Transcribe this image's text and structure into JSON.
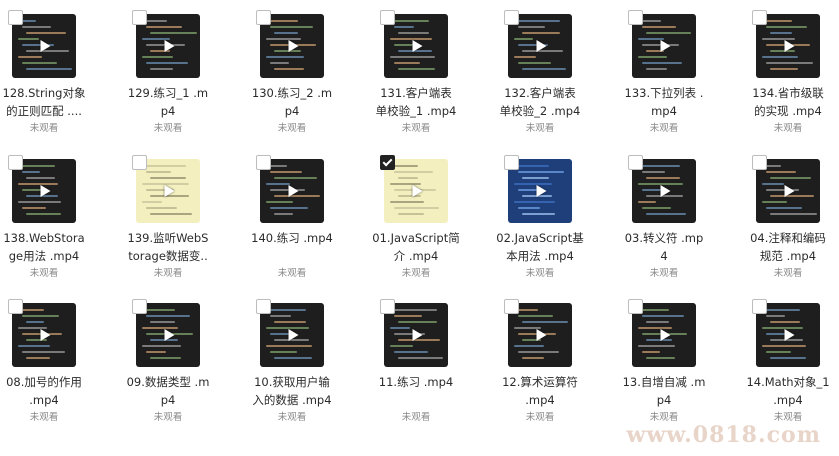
{
  "files": [
    {
      "name": "128.String对象\n的正则匹配 ....",
      "status": "未观看",
      "thumb": "dark",
      "checked": false
    },
    {
      "name": "129.练习_1 .m\np4",
      "status": "未观看",
      "thumb": "dark",
      "checked": false
    },
    {
      "name": "130.练习_2 .m\np4",
      "status": "未观看",
      "thumb": "dark",
      "checked": false
    },
    {
      "name": "131.客户端表\n单校验_1 .mp4",
      "status": "未观看",
      "thumb": "dark",
      "checked": false
    },
    {
      "name": "132.客户端表\n单校验_2 .mp4",
      "status": "未观看",
      "thumb": "dark",
      "checked": false
    },
    {
      "name": "133.下拉列表 .\nmp4",
      "status": "未观看",
      "thumb": "dark",
      "checked": false
    },
    {
      "name": "134.省市级联\n的实现 .mp4",
      "status": "未观看",
      "thumb": "dark",
      "checked": false
    },
    {
      "name": "138.WebStora\nge用法 .mp4",
      "status": "未观看",
      "thumb": "dark",
      "checked": false
    },
    {
      "name": "139.监听WebS\ntorage数据变..",
      "status": "未观看",
      "thumb": "yellow",
      "checked": false
    },
    {
      "name": "140.练习 .mp4",
      "status": "未观看",
      "thumb": "dark",
      "checked": false
    },
    {
      "name": "01.JavaScript简\n介 .mp4",
      "status": "未观看",
      "thumb": "yellow",
      "checked": true
    },
    {
      "name": "02.JavaScript基\n本用法 .mp4",
      "status": "未观看",
      "thumb": "blue",
      "checked": false
    },
    {
      "name": "03.转义符 .mp\n4",
      "status": "未观看",
      "thumb": "dark",
      "checked": false
    },
    {
      "name": "04.注释和编码\n规范 .mp4",
      "status": "未观看",
      "thumb": "dark",
      "checked": false
    },
    {
      "name": "08.加号的作用\n.mp4",
      "status": "未观看",
      "thumb": "dark",
      "checked": false
    },
    {
      "name": "09.数据类型 .m\np4",
      "status": "未观看",
      "thumb": "dark",
      "checked": false
    },
    {
      "name": "10.获取用户输\n入的数据 .mp4",
      "status": "未观看",
      "thumb": "dark",
      "checked": false
    },
    {
      "name": "11.练习 .mp4",
      "status": "未观看",
      "thumb": "dark",
      "checked": false
    },
    {
      "name": "12.算术运算符\n.mp4",
      "status": "未观看",
      "thumb": "dark",
      "checked": false
    },
    {
      "name": "13.自增自减 .m\np4",
      "status": "未观看",
      "thumb": "dark",
      "checked": false
    },
    {
      "name": "14.Math对象_1\n.mp4",
      "status": "未观看",
      "thumb": "dark",
      "checked": false
    }
  ],
  "watermark": "www.0818.com"
}
